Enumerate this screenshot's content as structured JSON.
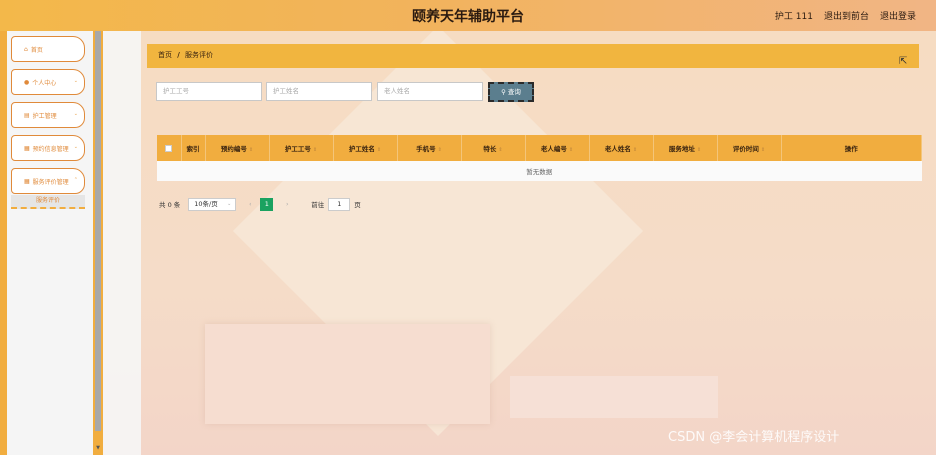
{
  "header": {
    "title": "颐养天年辅助平台",
    "user_label": "护工 111",
    "front_link": "退出到前台",
    "logout_link": "退出登录"
  },
  "sidebar": {
    "items": [
      {
        "icon": "home-icon",
        "glyph": "⌂",
        "label": "首页"
      },
      {
        "icon": "user-icon",
        "glyph": "👤",
        "label": "个人中心"
      },
      {
        "icon": "worker-icon",
        "glyph": "▤",
        "label": "护工管理"
      },
      {
        "icon": "calendar-icon",
        "glyph": "▦",
        "label": "预约信息管理"
      },
      {
        "icon": "grid-icon",
        "glyph": "▦",
        "label": "服务评价管理"
      }
    ],
    "submenu_item": "服务评价"
  },
  "breadcrumb": {
    "home": "首页",
    "separator": "/",
    "current": "服务评价"
  },
  "search": {
    "worker_id_placeholder": "护工工号",
    "worker_name_placeholder": "护工姓名",
    "elder_name_placeholder": "老人姓名",
    "button_label": "查询",
    "button_icon": "search-icon"
  },
  "table": {
    "columns": [
      "索引",
      "预约编号",
      "护工工号",
      "护工姓名",
      "手机号",
      "特长",
      "老人编号",
      "老人姓名",
      "服务地址",
      "评价时间",
      "操作"
    ],
    "empty_text": "暂无数据"
  },
  "pagination": {
    "total_text": "共 0 条",
    "page_size": "10条/页",
    "current_page": "1",
    "goto_label": "前往",
    "goto_value": "1",
    "goto_unit": "页"
  },
  "watermark": "CSDN @李会计算机程序设计",
  "colors": {
    "accent": "#f1ad3f",
    "header_gradient_end": "#f1b585",
    "search_button": "#5b7e8e",
    "active_page": "#1aa260",
    "menu_text": "#e08a3a"
  }
}
